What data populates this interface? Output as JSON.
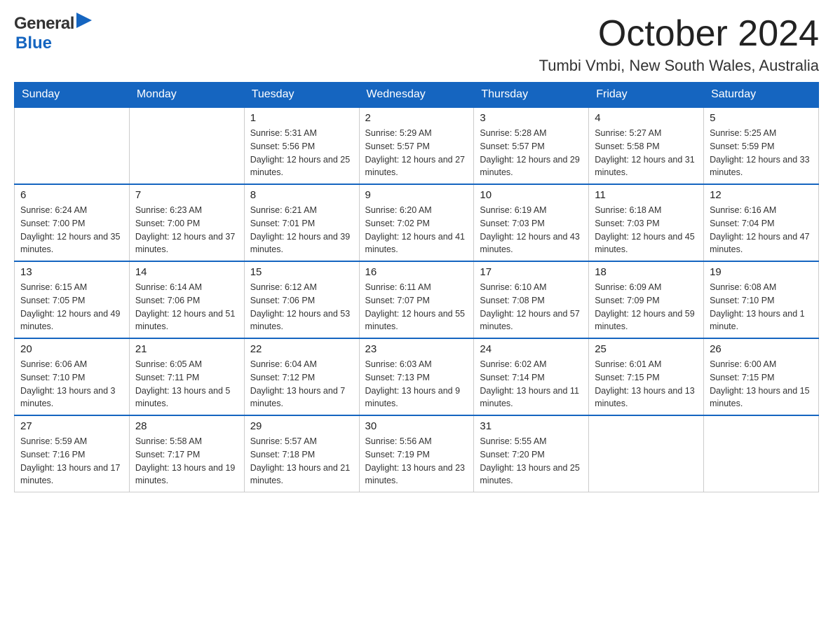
{
  "header": {
    "logo_general": "General",
    "logo_blue": "Blue",
    "title": "October 2024",
    "subtitle": "Tumbi Vmbi, New South Wales, Australia"
  },
  "calendar": {
    "days_of_week": [
      "Sunday",
      "Monday",
      "Tuesday",
      "Wednesday",
      "Thursday",
      "Friday",
      "Saturday"
    ],
    "weeks": [
      [
        {
          "day": "",
          "sunrise": "",
          "sunset": "",
          "daylight": ""
        },
        {
          "day": "",
          "sunrise": "",
          "sunset": "",
          "daylight": ""
        },
        {
          "day": "1",
          "sunrise": "Sunrise: 5:31 AM",
          "sunset": "Sunset: 5:56 PM",
          "daylight": "Daylight: 12 hours and 25 minutes."
        },
        {
          "day": "2",
          "sunrise": "Sunrise: 5:29 AM",
          "sunset": "Sunset: 5:57 PM",
          "daylight": "Daylight: 12 hours and 27 minutes."
        },
        {
          "day": "3",
          "sunrise": "Sunrise: 5:28 AM",
          "sunset": "Sunset: 5:57 PM",
          "daylight": "Daylight: 12 hours and 29 minutes."
        },
        {
          "day": "4",
          "sunrise": "Sunrise: 5:27 AM",
          "sunset": "Sunset: 5:58 PM",
          "daylight": "Daylight: 12 hours and 31 minutes."
        },
        {
          "day": "5",
          "sunrise": "Sunrise: 5:25 AM",
          "sunset": "Sunset: 5:59 PM",
          "daylight": "Daylight: 12 hours and 33 minutes."
        }
      ],
      [
        {
          "day": "6",
          "sunrise": "Sunrise: 6:24 AM",
          "sunset": "Sunset: 7:00 PM",
          "daylight": "Daylight: 12 hours and 35 minutes."
        },
        {
          "day": "7",
          "sunrise": "Sunrise: 6:23 AM",
          "sunset": "Sunset: 7:00 PM",
          "daylight": "Daylight: 12 hours and 37 minutes."
        },
        {
          "day": "8",
          "sunrise": "Sunrise: 6:21 AM",
          "sunset": "Sunset: 7:01 PM",
          "daylight": "Daylight: 12 hours and 39 minutes."
        },
        {
          "day": "9",
          "sunrise": "Sunrise: 6:20 AM",
          "sunset": "Sunset: 7:02 PM",
          "daylight": "Daylight: 12 hours and 41 minutes."
        },
        {
          "day": "10",
          "sunrise": "Sunrise: 6:19 AM",
          "sunset": "Sunset: 7:03 PM",
          "daylight": "Daylight: 12 hours and 43 minutes."
        },
        {
          "day": "11",
          "sunrise": "Sunrise: 6:18 AM",
          "sunset": "Sunset: 7:03 PM",
          "daylight": "Daylight: 12 hours and 45 minutes."
        },
        {
          "day": "12",
          "sunrise": "Sunrise: 6:16 AM",
          "sunset": "Sunset: 7:04 PM",
          "daylight": "Daylight: 12 hours and 47 minutes."
        }
      ],
      [
        {
          "day": "13",
          "sunrise": "Sunrise: 6:15 AM",
          "sunset": "Sunset: 7:05 PM",
          "daylight": "Daylight: 12 hours and 49 minutes."
        },
        {
          "day": "14",
          "sunrise": "Sunrise: 6:14 AM",
          "sunset": "Sunset: 7:06 PM",
          "daylight": "Daylight: 12 hours and 51 minutes."
        },
        {
          "day": "15",
          "sunrise": "Sunrise: 6:12 AM",
          "sunset": "Sunset: 7:06 PM",
          "daylight": "Daylight: 12 hours and 53 minutes."
        },
        {
          "day": "16",
          "sunrise": "Sunrise: 6:11 AM",
          "sunset": "Sunset: 7:07 PM",
          "daylight": "Daylight: 12 hours and 55 minutes."
        },
        {
          "day": "17",
          "sunrise": "Sunrise: 6:10 AM",
          "sunset": "Sunset: 7:08 PM",
          "daylight": "Daylight: 12 hours and 57 minutes."
        },
        {
          "day": "18",
          "sunrise": "Sunrise: 6:09 AM",
          "sunset": "Sunset: 7:09 PM",
          "daylight": "Daylight: 12 hours and 59 minutes."
        },
        {
          "day": "19",
          "sunrise": "Sunrise: 6:08 AM",
          "sunset": "Sunset: 7:10 PM",
          "daylight": "Daylight: 13 hours and 1 minute."
        }
      ],
      [
        {
          "day": "20",
          "sunrise": "Sunrise: 6:06 AM",
          "sunset": "Sunset: 7:10 PM",
          "daylight": "Daylight: 13 hours and 3 minutes."
        },
        {
          "day": "21",
          "sunrise": "Sunrise: 6:05 AM",
          "sunset": "Sunset: 7:11 PM",
          "daylight": "Daylight: 13 hours and 5 minutes."
        },
        {
          "day": "22",
          "sunrise": "Sunrise: 6:04 AM",
          "sunset": "Sunset: 7:12 PM",
          "daylight": "Daylight: 13 hours and 7 minutes."
        },
        {
          "day": "23",
          "sunrise": "Sunrise: 6:03 AM",
          "sunset": "Sunset: 7:13 PM",
          "daylight": "Daylight: 13 hours and 9 minutes."
        },
        {
          "day": "24",
          "sunrise": "Sunrise: 6:02 AM",
          "sunset": "Sunset: 7:14 PM",
          "daylight": "Daylight: 13 hours and 11 minutes."
        },
        {
          "day": "25",
          "sunrise": "Sunrise: 6:01 AM",
          "sunset": "Sunset: 7:15 PM",
          "daylight": "Daylight: 13 hours and 13 minutes."
        },
        {
          "day": "26",
          "sunrise": "Sunrise: 6:00 AM",
          "sunset": "Sunset: 7:15 PM",
          "daylight": "Daylight: 13 hours and 15 minutes."
        }
      ],
      [
        {
          "day": "27",
          "sunrise": "Sunrise: 5:59 AM",
          "sunset": "Sunset: 7:16 PM",
          "daylight": "Daylight: 13 hours and 17 minutes."
        },
        {
          "day": "28",
          "sunrise": "Sunrise: 5:58 AM",
          "sunset": "Sunset: 7:17 PM",
          "daylight": "Daylight: 13 hours and 19 minutes."
        },
        {
          "day": "29",
          "sunrise": "Sunrise: 5:57 AM",
          "sunset": "Sunset: 7:18 PM",
          "daylight": "Daylight: 13 hours and 21 minutes."
        },
        {
          "day": "30",
          "sunrise": "Sunrise: 5:56 AM",
          "sunset": "Sunset: 7:19 PM",
          "daylight": "Daylight: 13 hours and 23 minutes."
        },
        {
          "day": "31",
          "sunrise": "Sunrise: 5:55 AM",
          "sunset": "Sunset: 7:20 PM",
          "daylight": "Daylight: 13 hours and 25 minutes."
        },
        {
          "day": "",
          "sunrise": "",
          "sunset": "",
          "daylight": ""
        },
        {
          "day": "",
          "sunrise": "",
          "sunset": "",
          "daylight": ""
        }
      ]
    ]
  }
}
